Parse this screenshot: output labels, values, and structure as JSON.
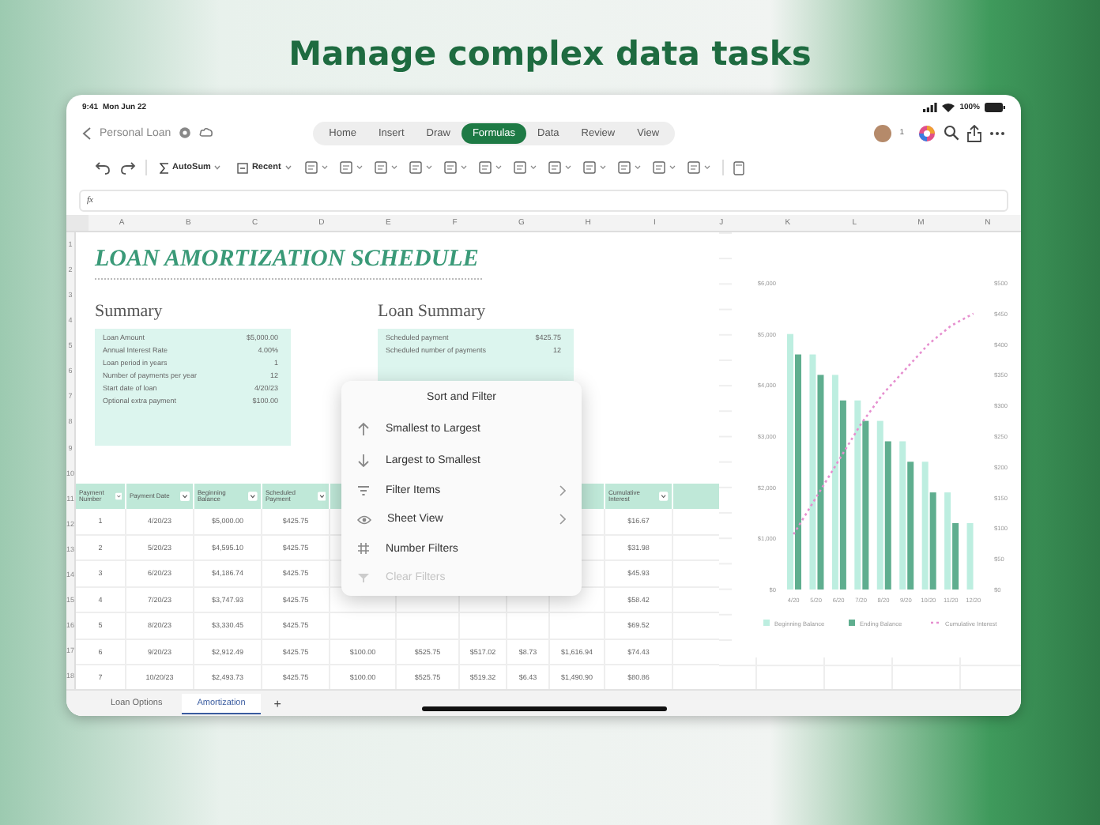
{
  "headline": "Manage complex data tasks",
  "status_bar": {
    "time": "9:41",
    "date": "Mon Jun 22",
    "battery": "100%"
  },
  "document": {
    "title": "Personal Loan",
    "collaborators": "1"
  },
  "tabs": [
    {
      "label": "Home",
      "selected": false
    },
    {
      "label": "Insert",
      "selected": false
    },
    {
      "label": "Draw",
      "selected": false
    },
    {
      "label": "Formulas",
      "selected": true
    },
    {
      "label": "Data",
      "selected": false
    },
    {
      "label": "Review",
      "selected": false
    },
    {
      "label": "View",
      "selected": false
    }
  ],
  "toolbar": {
    "autosum": "AutoSum",
    "recent": "Recent"
  },
  "formula_bar": {
    "label": "fx"
  },
  "column_letters": [
    "A",
    "B",
    "C",
    "D",
    "E",
    "F",
    "G",
    "H",
    "I",
    "J",
    "K",
    "L",
    "M",
    "N"
  ],
  "row_numbers": [
    "1",
    "2",
    "3",
    "4",
    "5",
    "6",
    "7",
    "8",
    "9",
    "10",
    "11",
    "12",
    "13",
    "14",
    "15",
    "16",
    "17",
    "18"
  ],
  "sheet_title": "LOAN AMORTIZATION SCHEDULE",
  "summary": {
    "title": "Summary",
    "rows": [
      {
        "label": "Loan Amount",
        "value": "$5,000.00"
      },
      {
        "label": "Annual Interest Rate",
        "value": "4.00%"
      },
      {
        "label": "Loan period in years",
        "value": "1"
      },
      {
        "label": "Number of payments per year",
        "value": "12"
      },
      {
        "label": "Start date of loan",
        "value": "4/20/23"
      },
      {
        "label": "Optional extra payment",
        "value": "$100.00"
      }
    ]
  },
  "loan_summary": {
    "title": "Loan Summary",
    "rows": [
      {
        "label": "Scheduled payment",
        "value": "$425.75"
      },
      {
        "label": "Scheduled number of payments",
        "value": "12"
      }
    ]
  },
  "table": {
    "columns": [
      "Payment Number",
      "Payment Date",
      "Beginning Balance",
      "Scheduled Payment",
      null,
      null,
      null,
      null,
      null,
      "Cumulative Interest"
    ],
    "rows": [
      [
        "1",
        "4/20/23",
        "$5,000.00",
        "$425.75",
        null,
        null,
        null,
        null,
        null,
        "$16.67"
      ],
      [
        "2",
        "5/20/23",
        "$4,595.10",
        "$425.75",
        null,
        null,
        null,
        null,
        null,
        "$31.98"
      ],
      [
        "3",
        "6/20/23",
        "$4,186.74",
        "$425.75",
        null,
        null,
        null,
        null,
        null,
        "$45.93"
      ],
      [
        "4",
        "7/20/23",
        "$3,747.93",
        "$425.75",
        null,
        null,
        null,
        null,
        null,
        "$58.42"
      ],
      [
        "5",
        "8/20/23",
        "$3,330.45",
        "$425.75",
        null,
        null,
        null,
        null,
        null,
        "$69.52"
      ],
      [
        "6",
        "9/20/23",
        "$2,912.49",
        "$425.75",
        "$100.00",
        "$525.75",
        "$517.02",
        "$8.73",
        "$1,616.94",
        "$74.43"
      ],
      [
        "7",
        "10/20/23",
        "$2,493.73",
        "$425.75",
        "$100.00",
        "$525.75",
        "$519.32",
        "$6.43",
        "$1,490.90",
        "$80.86"
      ]
    ]
  },
  "menu": {
    "title": "Sort and Filter",
    "items": [
      {
        "label": "Smallest to Largest",
        "kind": "sort-up",
        "submenu": false,
        "disabled": false
      },
      {
        "label": "Largest to Smallest",
        "kind": "sort-down",
        "submenu": false,
        "disabled": false
      },
      {
        "label": "Filter Items",
        "kind": "filter",
        "submenu": true,
        "disabled": false
      },
      {
        "label": "Sheet View",
        "kind": "view",
        "submenu": true,
        "disabled": false
      },
      {
        "label": "Number Filters",
        "kind": "number",
        "submenu": false,
        "disabled": false
      },
      {
        "label": "Clear Filters",
        "kind": "clear",
        "submenu": false,
        "disabled": true
      }
    ]
  },
  "chart": {
    "chart_data": {
      "type": "bar",
      "stacked": false,
      "legend": "bottom",
      "ylim": [
        0,
        6000
      ],
      "categories": [
        "4/20",
        "5/20",
        "6/20",
        "7/20",
        "8/20",
        "9/20",
        "10/20",
        "11/20",
        "12/20"
      ],
      "yticks": [
        {
          "value": 0,
          "label": "$0"
        },
        {
          "value": 1000,
          "label": "$1,000"
        },
        {
          "value": 2000,
          "label": "$2,000"
        },
        {
          "value": 3000,
          "label": "$3,000"
        },
        {
          "value": 4000,
          "label": "$4,000"
        },
        {
          "value": 5000,
          "label": "$5,000"
        },
        {
          "value": 6000,
          "label": "$6,000"
        }
      ],
      "series": [
        {
          "name": "Beginning Balance",
          "color": "#bdeee0",
          "values": [
            5000,
            4600,
            4200,
            3700,
            3300,
            2900,
            2500,
            1900,
            1300
          ]
        },
        {
          "name": "Ending Balance",
          "color": "#5fae8f",
          "values": [
            4600,
            4200,
            3700,
            3300,
            2900,
            2500,
            1900,
            1300,
            null
          ]
        }
      ]
    }
  },
  "chart_overlay": {
    "chart_data": {
      "type": "line",
      "legend": "bottom",
      "ylim": [
        0,
        500
      ],
      "yticks": [
        {
          "value": 0,
          "label": "$0"
        },
        {
          "value": 50,
          "label": "$50"
        },
        {
          "value": 100,
          "label": "$100"
        },
        {
          "value": 150,
          "label": "$150"
        },
        {
          "value": 200,
          "label": "$200"
        },
        {
          "value": 250,
          "label": "$250"
        },
        {
          "value": 300,
          "label": "$300"
        },
        {
          "value": 350,
          "label": "$350"
        },
        {
          "value": 400,
          "label": "$400"
        },
        {
          "value": 450,
          "label": "$450"
        },
        {
          "value": 500,
          "label": "$500"
        }
      ],
      "series": [
        {
          "name": "Cumulative Interest",
          "color": "#e68fcf",
          "line_style": "dotted",
          "values": [
            90,
            150,
            210,
            270,
            320,
            360,
            400,
            430,
            450
          ]
        }
      ]
    }
  },
  "sheet_tabs": [
    {
      "label": "Loan Options",
      "selected": false
    },
    {
      "label": "Amortization",
      "selected": true
    }
  ],
  "add_sheet": "+"
}
